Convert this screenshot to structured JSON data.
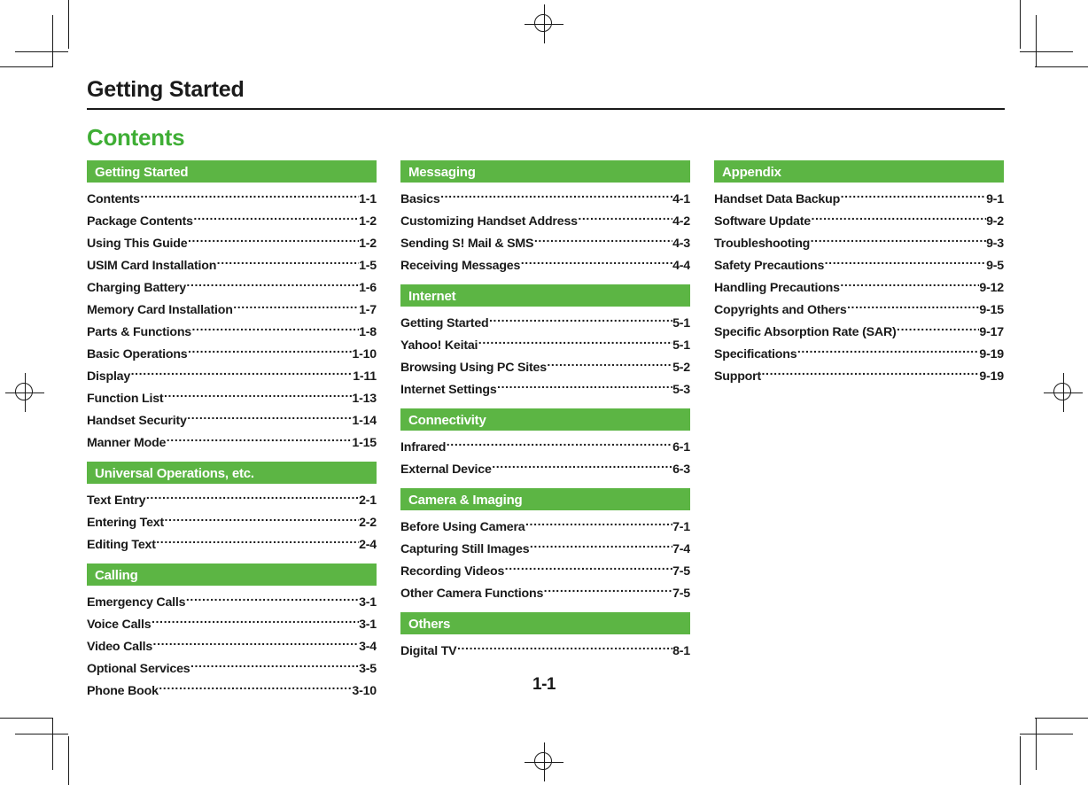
{
  "document": {
    "running_head": "Getting Started",
    "contents_heading": "Contents",
    "folio": "1-1"
  },
  "colors": {
    "accent_green": "#5cb544",
    "heading_green": "#3fae35",
    "text": "#1a1a1a",
    "bar_text": "#ffffff"
  },
  "columns": [
    {
      "sections": [
        {
          "title": "Getting Started",
          "entries": [
            {
              "label": "Contents",
              "page": "1-1"
            },
            {
              "label": "Package Contents",
              "page": "1-2"
            },
            {
              "label": "Using This Guide",
              "page": "1-2"
            },
            {
              "label": "USIM Card Installation",
              "page": "1-5"
            },
            {
              "label": "Charging Battery",
              "page": "1-6"
            },
            {
              "label": "Memory Card Installation",
              "page": "1-7"
            },
            {
              "label": "Parts & Functions",
              "page": "1-8"
            },
            {
              "label": "Basic Operations",
              "page": "1-10"
            },
            {
              "label": "Display",
              "page": "1-11"
            },
            {
              "label": "Function List",
              "page": "1-13"
            },
            {
              "label": "Handset Security",
              "page": "1-14"
            },
            {
              "label": "Manner Mode",
              "page": "1-15"
            }
          ]
        },
        {
          "title": "Universal Operations, etc.",
          "entries": [
            {
              "label": "Text Entry",
              "page": "2-1"
            },
            {
              "label": "Entering Text",
              "page": "2-2"
            },
            {
              "label": "Editing Text",
              "page": "2-4"
            }
          ]
        },
        {
          "title": "Calling",
          "entries": [
            {
              "label": "Emergency Calls",
              "page": "3-1"
            },
            {
              "label": "Voice Calls",
              "page": "3-1"
            },
            {
              "label": "Video Calls",
              "page": "3-4"
            },
            {
              "label": "Optional Services",
              "page": "3-5"
            },
            {
              "label": "Phone Book",
              "page": "3-10"
            }
          ]
        }
      ]
    },
    {
      "sections": [
        {
          "title": "Messaging",
          "entries": [
            {
              "label": "Basics",
              "page": "4-1"
            },
            {
              "label": "Customizing Handset Address",
              "page": "4-2"
            },
            {
              "label": "Sending S! Mail & SMS",
              "page": "4-3"
            },
            {
              "label": "Receiving Messages",
              "page": "4-4"
            }
          ]
        },
        {
          "title": "Internet",
          "entries": [
            {
              "label": "Getting Started",
              "page": "5-1"
            },
            {
              "label": "Yahoo! Keitai",
              "page": "5-1"
            },
            {
              "label": "Browsing Using PC Sites",
              "page": "5-2"
            },
            {
              "label": "Internet Settings",
              "page": "5-3"
            }
          ]
        },
        {
          "title": "Connectivity",
          "entries": [
            {
              "label": "Infrared",
              "page": "6-1"
            },
            {
              "label": "External Device",
              "page": "6-3"
            }
          ]
        },
        {
          "title": "Camera & Imaging",
          "entries": [
            {
              "label": "Before Using Camera",
              "page": "7-1"
            },
            {
              "label": "Capturing Still Images",
              "page": "7-4"
            },
            {
              "label": "Recording Videos",
              "page": "7-5"
            },
            {
              "label": "Other Camera Functions",
              "page": "7-5"
            }
          ]
        },
        {
          "title": "Others",
          "entries": [
            {
              "label": "Digital TV",
              "page": "8-1"
            }
          ]
        }
      ]
    },
    {
      "sections": [
        {
          "title": "Appendix",
          "entries": [
            {
              "label": "Handset Data Backup",
              "page": "9-1"
            },
            {
              "label": "Software Update",
              "page": "9-2"
            },
            {
              "label": "Troubleshooting",
              "page": "9-3"
            },
            {
              "label": "Safety Precautions",
              "page": "9-5"
            },
            {
              "label": "Handling Precautions",
              "page": "9-12"
            },
            {
              "label": "Copyrights and Others",
              "page": "9-15"
            },
            {
              "label": "Specific Absorption Rate (SAR)",
              "page": "9-17"
            },
            {
              "label": "Specifications",
              "page": "9-19"
            },
            {
              "label": "Support",
              "page": "9-19"
            }
          ]
        }
      ]
    }
  ]
}
